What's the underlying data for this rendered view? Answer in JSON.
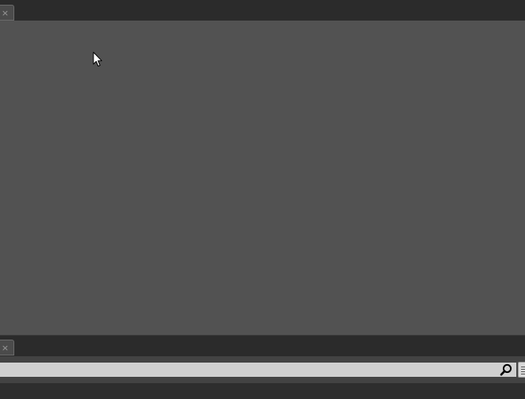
{
  "top_tab": {
    "close_glyph": "×"
  },
  "bottom_tab": {
    "close_glyph": "×"
  },
  "search": {
    "value": "",
    "placeholder": ""
  },
  "icons": {
    "close": "close-icon",
    "cursor": "mouse-cursor-icon",
    "search": "search-icon",
    "list": "list-view-icon"
  },
  "colors": {
    "panel_background": "#525252",
    "tabbar_background": "#2b2b2b",
    "search_field": "#d0d0d0"
  }
}
